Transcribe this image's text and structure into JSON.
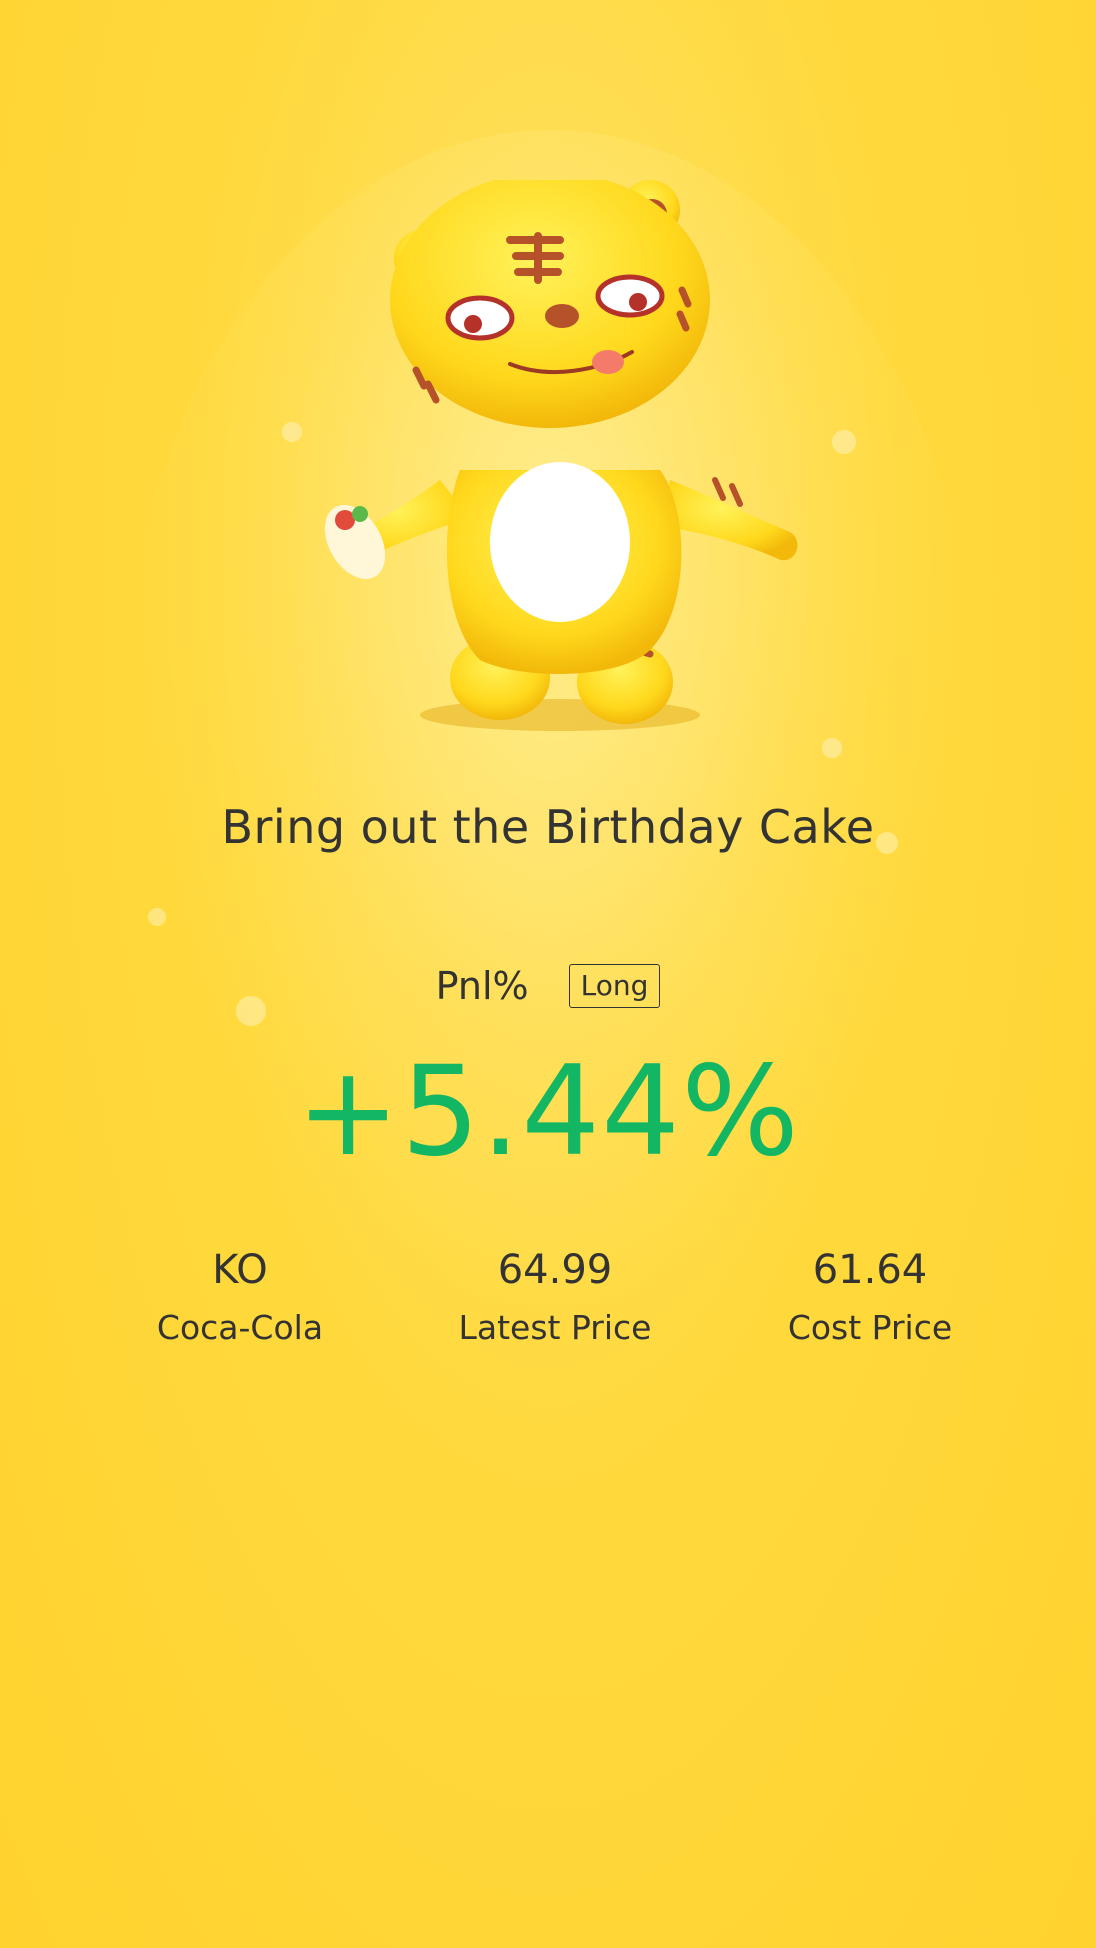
{
  "share_card": {
    "title": "Bring out the Birthday Cake",
    "pnl_label": "Pnl%",
    "position_side": "Long",
    "pnl_value": "+5.44%",
    "pnl_color": "#13b663",
    "mascot": "tiger-mascot-icon"
  },
  "stats": [
    {
      "value": "KO",
      "label": "Coca-Cola"
    },
    {
      "value": "64.99",
      "label": "Latest Price"
    },
    {
      "value": "61.64",
      "label": "Cost Price"
    }
  ]
}
